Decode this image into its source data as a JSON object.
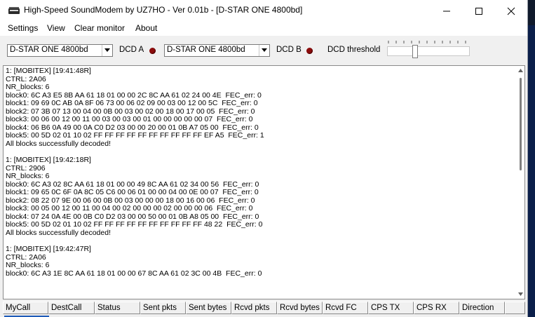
{
  "window": {
    "title": "High-Speed SoundModem by UZ7HO - Ver 0.01b - [D-STAR ONE 4800bd]"
  },
  "icons": {
    "app": "modem-icon",
    "minimize": "minimize-icon",
    "maximize": "maximize-icon",
    "close": "close-icon",
    "dropdown": "chevron-down-icon"
  },
  "menu": {
    "items": [
      "Settings",
      "View",
      "Clear monitor",
      "About"
    ]
  },
  "toolbar": {
    "modem_a": "D-STAR ONE 4800bd",
    "dcd_a_label": "DCD A",
    "modem_b": "D-STAR ONE 4800bd",
    "dcd_b_label": "DCD B",
    "dcd_threshold_label": "DCD threshold",
    "dcd_threshold_level": 0.33,
    "led_color": "#8c0c0c"
  },
  "monitor": {
    "lines": [
      "1: [MOBITEX] [19:41:48R]",
      "CTRL: 2A06",
      "NR_blocks: 6",
      "block0: 6C A3 E5 8B AA 61 18 01 00 00 2C 8C AA 61 02 24 00 4E  FEC_err: 0",
      "block1: 09 69 0C AB 0A 8F 06 73 00 06 02 09 00 03 00 12 00 5C  FEC_err: 0",
      "block2: 07 3B 07 13 00 04 00 0B 00 03 00 02 00 18 00 17 00 05  FEC_err: 0",
      "block3: 00 06 00 12 00 11 00 03 00 03 00 01 00 00 00 00 00 07  FEC_err: 0",
      "block4: 06 B6 0A 49 00 0A C0 D2 03 00 00 20 00 01 0B A7 05 00  FEC_err: 0",
      "block5: 00 5D 02 01 10 02 FF FF FF FF FF FF FF FF FF FF EF A5  FEC_err: 1",
      "All blocks successfully decoded!",
      "",
      "1: [MOBITEX] [19:42:18R]",
      "CTRL: 2906",
      "NR_blocks: 6",
      "block0: 6C A3 02 8C AA 61 18 01 00 00 49 8C AA 61 02 34 00 56  FEC_err: 0",
      "block1: 09 65 0C 6F 0A 8C 05 C6 00 06 01 00 00 04 00 0E 00 07  FEC_err: 0",
      "block2: 08 22 07 9E 00 06 00 0B 00 03 00 00 00 18 00 16 00 06  FEC_err: 0",
      "block3: 00 05 00 12 00 11 00 04 00 02 00 00 00 02 00 00 00 06  FEC_err: 0",
      "block4: 07 24 0A 4E 00 0B C0 D2 03 00 00 50 00 01 0B A8 05 00  FEC_err: 0",
      "block5: 00 5D 02 01 10 02 FF FF FF FF FF FF FF FF FF FF 48 22  FEC_err: 0",
      "All blocks successfully decoded!",
      "",
      "1: [MOBITEX] [19:42:47R]",
      "CTRL: 2A06",
      "NR_blocks: 6",
      "block0: 6C A3 1E 8C AA 61 18 01 00 00 67 8C AA 61 02 3C 00 4B  FEC_err: 0"
    ]
  },
  "columns": [
    "MyCall",
    "DestCall",
    "Status",
    "Sent pkts",
    "Sent bytes",
    "Rcvd pkts",
    "Rcvd bytes",
    "Rcvd FC",
    "CPS TX",
    "CPS RX",
    "Direction"
  ]
}
